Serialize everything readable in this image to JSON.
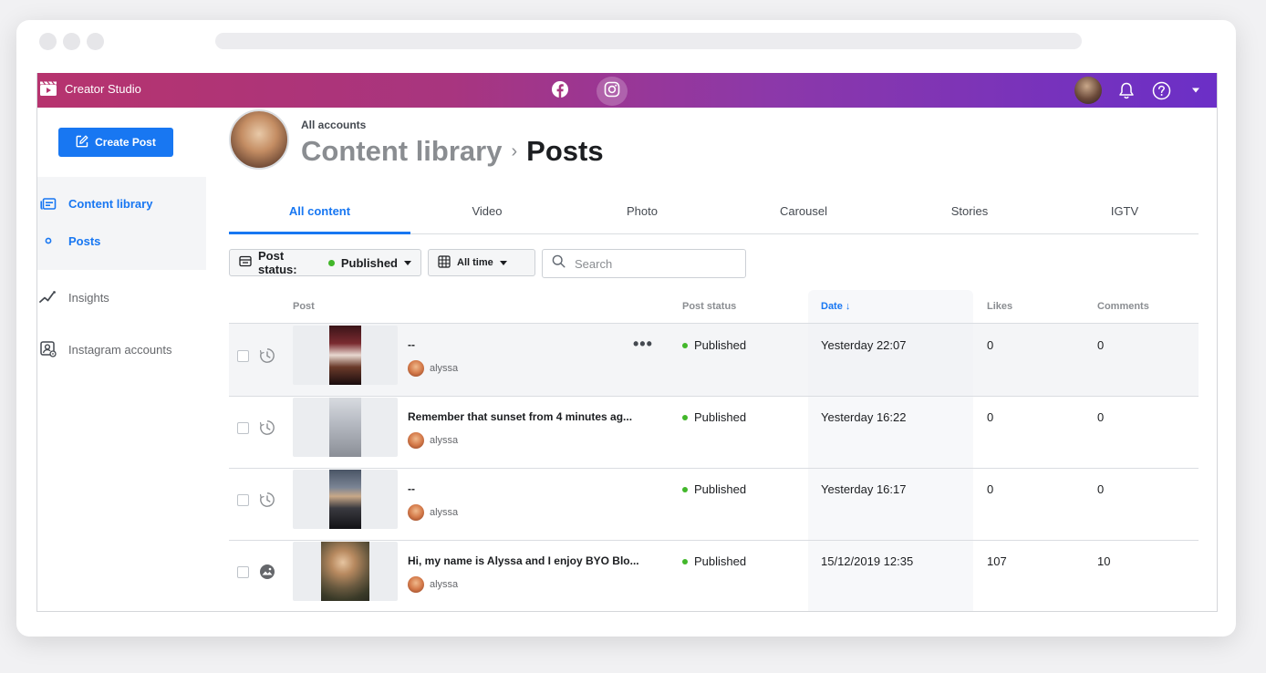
{
  "app": {
    "name": "Creator Studio"
  },
  "sidebar": {
    "create_post_label": "Create Post",
    "items": [
      {
        "label": "Content library",
        "icon": "content-library-icon",
        "active": true
      },
      {
        "label": "Posts",
        "icon": "circle-bullet-icon",
        "active": true
      },
      {
        "label": "Insights",
        "icon": "insights-icon",
        "active": false
      },
      {
        "label": "Instagram accounts",
        "icon": "instagram-accounts-icon",
        "active": false
      }
    ]
  },
  "header": {
    "account_label": "All accounts",
    "breadcrumb_parent": "Content library",
    "breadcrumb_separator": "›",
    "breadcrumb_current": "Posts"
  },
  "tabs": [
    {
      "label": "All content",
      "active": true
    },
    {
      "label": "Video",
      "active": false
    },
    {
      "label": "Photo",
      "active": false
    },
    {
      "label": "Carousel",
      "active": false
    },
    {
      "label": "Stories",
      "active": false
    },
    {
      "label": "IGTV",
      "active": false
    }
  ],
  "filters": {
    "post_status_label": "Post status:",
    "post_status_value": "Published",
    "time_label": "All time",
    "search_placeholder": "Search"
  },
  "table": {
    "columns": {
      "post": "Post",
      "post_status": "Post status",
      "date": "Date ↓",
      "likes": "Likes",
      "comments": "Comments"
    },
    "rows": [
      {
        "title": "--",
        "author": "alyssa",
        "status": "Published",
        "date": "Yesterday 22:07",
        "likes": "0",
        "comments": "0",
        "type_icon": "clock-icon"
      },
      {
        "title": "Remember that sunset from 4 minutes ag...",
        "author": "alyssa",
        "status": "Published",
        "date": "Yesterday 16:22",
        "likes": "0",
        "comments": "0",
        "type_icon": "clock-icon"
      },
      {
        "title": "--",
        "author": "alyssa",
        "status": "Published",
        "date": "Yesterday 16:17",
        "likes": "0",
        "comments": "0",
        "type_icon": "clock-icon"
      },
      {
        "title": "Hi, my name is Alyssa and I enjoy BYO Blo...",
        "author": "alyssa",
        "status": "Published",
        "date": "15/12/2019 12:35",
        "likes": "107",
        "comments": "10",
        "type_icon": "photo-icon"
      }
    ],
    "more_label": "•••"
  },
  "colors": {
    "accent": "#1877f2",
    "published": "#42b72a",
    "topbar_start": "#b6336e",
    "topbar_end": "#6b2fc7"
  }
}
